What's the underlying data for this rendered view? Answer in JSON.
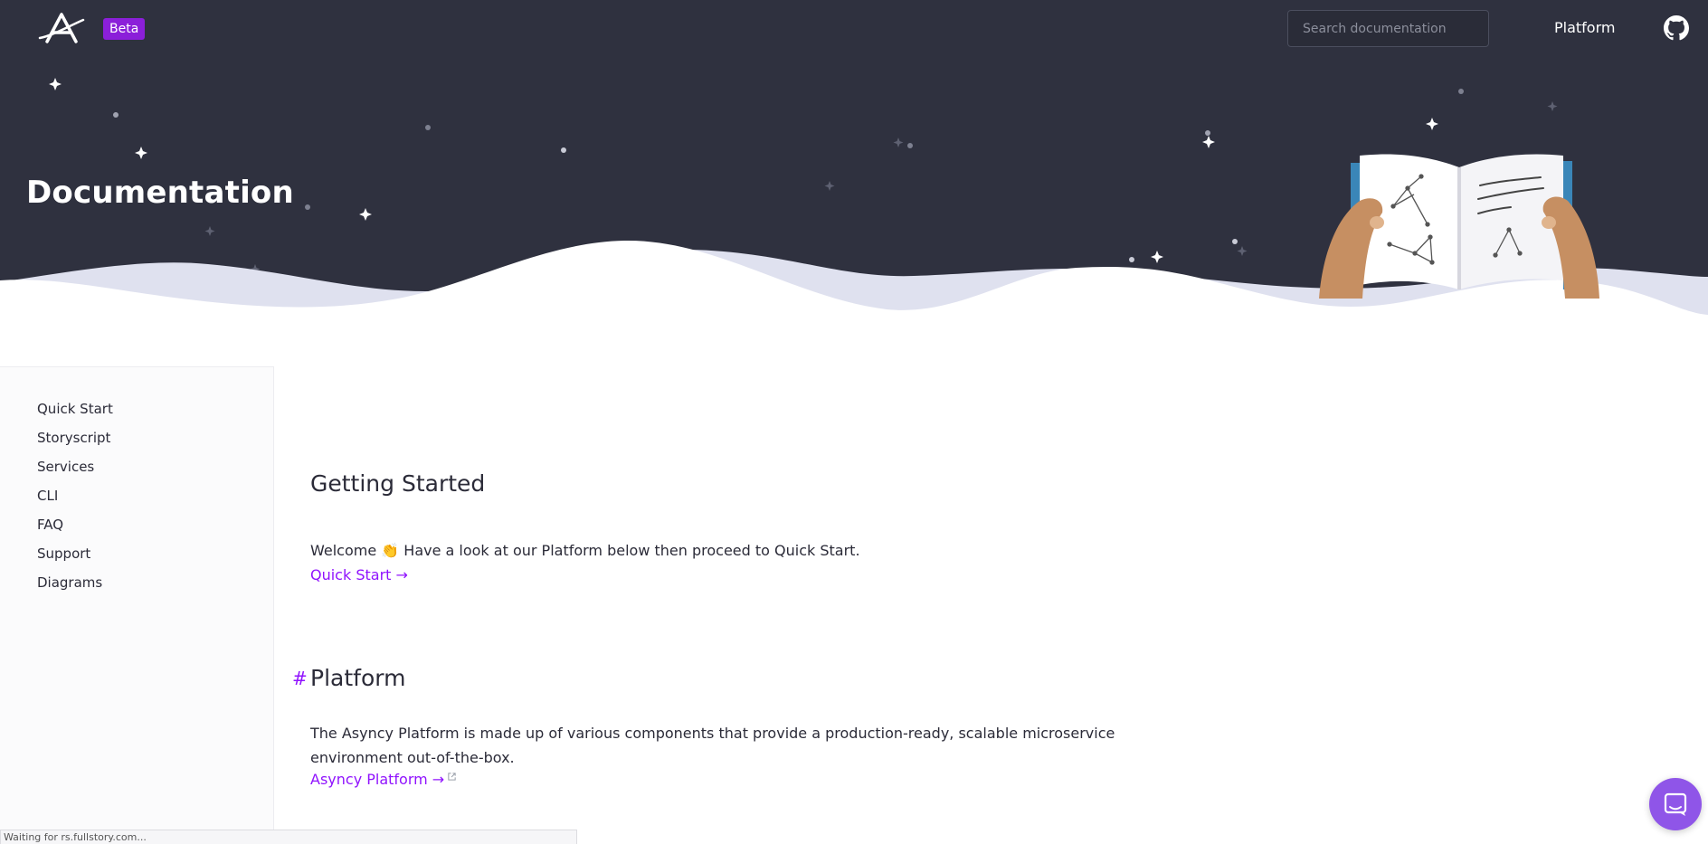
{
  "header": {
    "beta_label": "Beta",
    "search_placeholder": "Search documentation",
    "nav_platform": "Platform"
  },
  "hero": {
    "title": "Documentation"
  },
  "sidebar": {
    "items": [
      {
        "label": "Quick Start"
      },
      {
        "label": "Storyscript"
      },
      {
        "label": "Services"
      },
      {
        "label": "CLI"
      },
      {
        "label": "FAQ"
      },
      {
        "label": "Support"
      },
      {
        "label": "Diagrams"
      }
    ]
  },
  "main": {
    "getting_started_heading": "Getting Started",
    "welcome_text": "Welcome 👏 Have a look at our Platform below then proceed to Quick Start.",
    "quick_start_link": "Quick Start →",
    "platform_anchor": "#",
    "platform_heading": "Platform",
    "platform_description": "The Asyncy Platform is made up of various components that provide a production-ready, scalable microservice environment out-of-the-box.",
    "asyncy_platform_link": "Asyncy Platform →"
  },
  "status_bar": {
    "text": "Waiting for rs.fullstory.com..."
  },
  "colors": {
    "hero_bg": "#2f313f",
    "accent": "#9013fe",
    "beta_bg": "#8b1fd9",
    "wave": "#dfe1ef"
  },
  "icons": [
    "asyncy-logo-icon",
    "github-icon",
    "external-link-icon",
    "chat-icon",
    "book-illustration"
  ]
}
